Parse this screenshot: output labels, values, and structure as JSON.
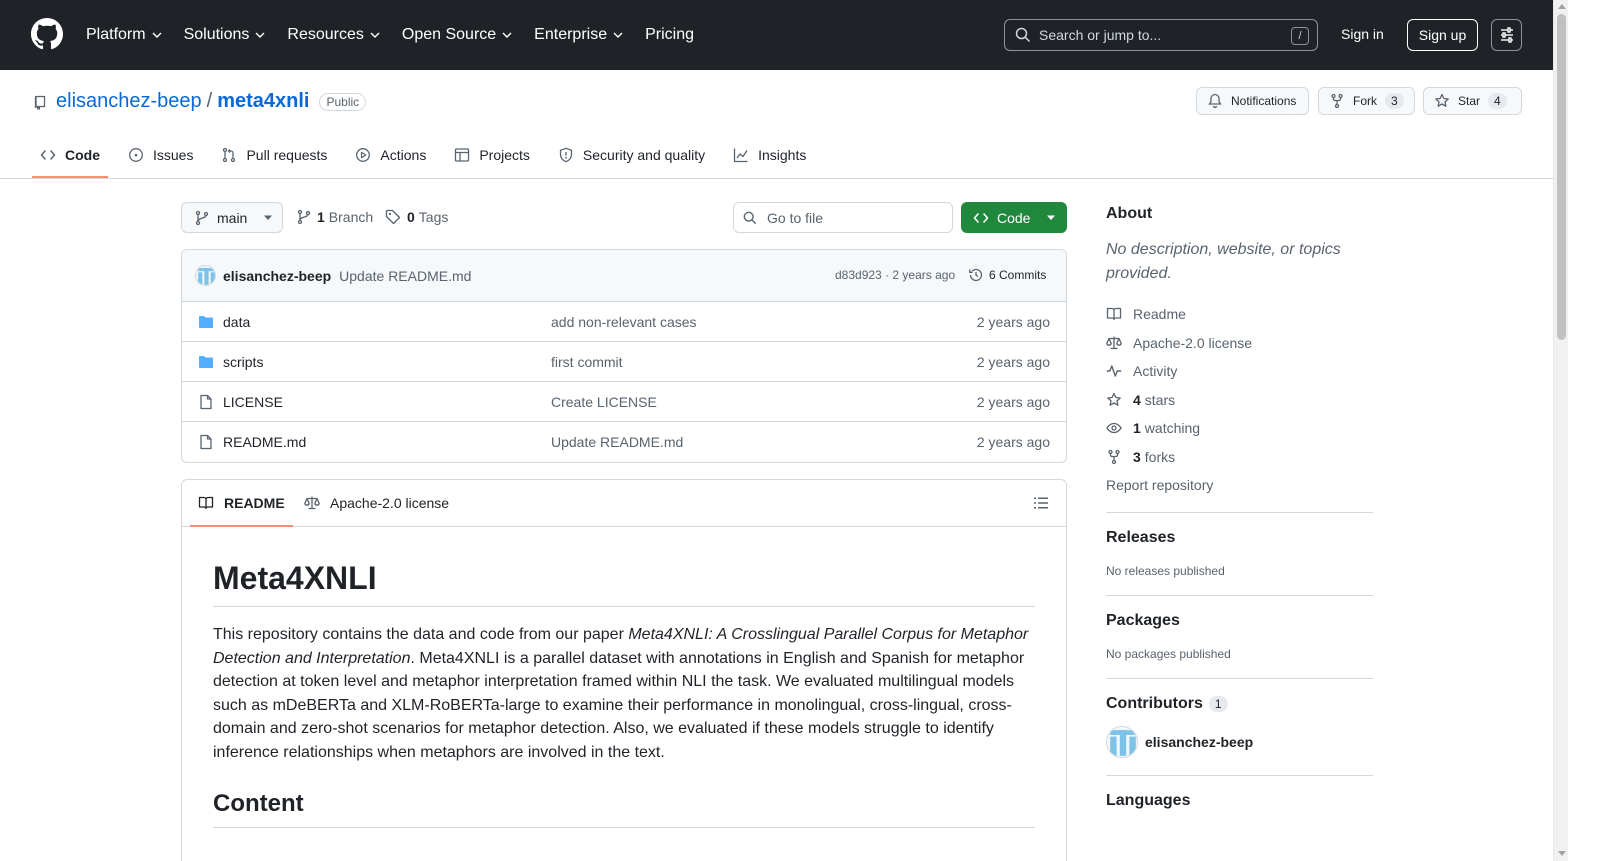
{
  "header": {
    "nav": [
      "Platform",
      "Solutions",
      "Resources",
      "Open Source",
      "Enterprise",
      "Pricing"
    ],
    "nav_has_chevron": [
      true,
      true,
      true,
      true,
      true,
      false
    ],
    "search_placeholder": "Search or jump to...",
    "search_shortcut": "/",
    "signin": "Sign in",
    "signup": "Sign up"
  },
  "repo": {
    "owner": "elisanchez-beep",
    "separator": "/",
    "name": "meta4xnli",
    "visibility": "Public",
    "notifications": "Notifications",
    "fork_label": "Fork",
    "fork_count": "3",
    "star_label": "Star",
    "star_count": "4"
  },
  "tabs": [
    {
      "label": "Code",
      "icon": "code-icon",
      "active": true
    },
    {
      "label": "Issues",
      "icon": "issue-icon"
    },
    {
      "label": "Pull requests",
      "icon": "pull-request-icon"
    },
    {
      "label": "Actions",
      "icon": "play-icon"
    },
    {
      "label": "Projects",
      "icon": "table-icon"
    },
    {
      "label": "Security and quality",
      "icon": "shield-icon"
    },
    {
      "label": "Insights",
      "icon": "graph-icon"
    }
  ],
  "toolbar": {
    "branch": "main",
    "branch_count": "1",
    "branch_label": "Branch",
    "tag_count": "0",
    "tag_label": "Tags",
    "goto_placeholder": "Go to file",
    "code_button": "Code"
  },
  "commit": {
    "author": "elisanchez-beep",
    "message": "Update README.md",
    "hash": "d83d923",
    "dot": "·",
    "age": "2 years ago",
    "commits": "6 Commits"
  },
  "files": [
    {
      "name": "data",
      "type": "folder",
      "message": "add non-relevant cases",
      "age": "2 years ago"
    },
    {
      "name": "scripts",
      "type": "folder",
      "message": "first commit",
      "age": "2 years ago"
    },
    {
      "name": "LICENSE",
      "type": "file",
      "message": "Create LICENSE",
      "age": "2 years ago"
    },
    {
      "name": "README.md",
      "type": "file",
      "message": "Update README.md",
      "age": "2 years ago"
    }
  ],
  "readme": {
    "tab_readme": "README",
    "tab_license": "Apache-2.0 license",
    "title": "Meta4XNLI",
    "p_intro": "This repository contains the data and code from our paper ",
    "p_paper": "Meta4XNLI: A Crosslingual Parallel Corpus for Metaphor Detection and Interpretation",
    "p_rest": ". Meta4XNLI is a parallel dataset with annotations in English and Spanish for metaphor detection at token level and metaphor interpretation framed within NLI the task. We evaluated multilingual models such as mDeBERTa and XLM-RoBERTa-large to examine their performance in monolingual, cross-lingual, cross-domain and zero-shot scenarios for metaphor detection. Also, we evaluated if these models struggle to identify inference relationships when metaphors are involved in the text.",
    "h2": "Content"
  },
  "sidebar": {
    "about_title": "About",
    "about_desc": "No description, website, or topics provided.",
    "links": [
      {
        "icon": "book-icon",
        "bold": "",
        "text": "Readme"
      },
      {
        "icon": "law-icon",
        "bold": "",
        "text": "Apache-2.0 license"
      },
      {
        "icon": "pulse-icon",
        "bold": "",
        "text": "Activity"
      },
      {
        "icon": "star-icon",
        "bold": "4",
        "text": "stars"
      },
      {
        "icon": "eye-icon",
        "bold": "1",
        "text": "watching"
      },
      {
        "icon": "fork-icon",
        "bold": "3",
        "text": "forks"
      }
    ],
    "report": "Report repository",
    "releases_title": "Releases",
    "releases_empty": "No releases published",
    "packages_title": "Packages",
    "packages_empty": "No packages published",
    "contributors_title": "Contributors",
    "contributors_count": "1",
    "contributor": "elisanchez-beep",
    "languages_title": "Languages"
  },
  "colors": {
    "header_bg": "#1f2328",
    "link": "#0969da",
    "primary_green": "#1f883d",
    "active_tab_underline": "#fd8c73",
    "folder": "#54aeff"
  }
}
